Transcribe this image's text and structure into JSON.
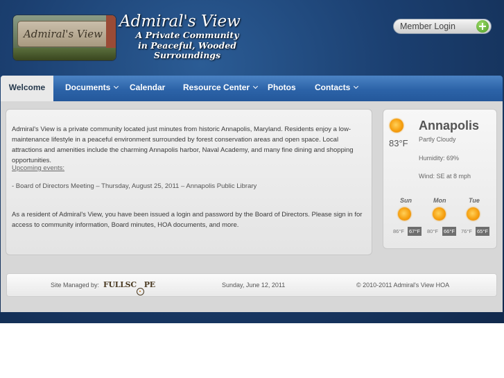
{
  "header": {
    "logo_sign_text": "Admiral's View",
    "site_title": "Admiral's View",
    "tagline_lines": [
      "A Private Community",
      "in Peaceful, Wooded",
      "Surroundings"
    ],
    "login_label": "Member Login"
  },
  "nav": {
    "items": [
      {
        "label": "Welcome",
        "active": true
      },
      {
        "label": "Documents",
        "dropdown": true
      },
      {
        "label": "Calendar"
      },
      {
        "label": "Resource Center",
        "dropdown": true
      },
      {
        "label": "Photos"
      },
      {
        "label": "Contacts",
        "dropdown": true
      }
    ]
  },
  "main": {
    "intro": "Admiral's View is a private community located just minutes from historic Annapolis, Maryland. Residents enjoy a low-maintenance lifestyle in a peaceful environment surrounded by forest conservation areas and open space. Local attractions and amenities include the charming Annapolis harbor, Naval Academy, and many fine dining and shopping opportunities.",
    "upcoming_label": "Upcoming events:",
    "event": "- Board of Directors Meeting – Thursday, August 25, 2011 – Annapolis Public Library",
    "login_note": "As a resident of Admiral's View, you have been issued a login and password by the Board of Directors. Please sign in for access to community information, Board minutes, HOA documents, and more."
  },
  "weather": {
    "city": "Annapolis",
    "temp": "83°F",
    "condition": "Partly Cloudy",
    "humidity": "Humidity: 69%",
    "wind": "Wind: SE at 8 mph",
    "forecast": [
      {
        "day": "Sun",
        "low": "86°F",
        "high": "67°F",
        "icon": "partly-cloudy-icon"
      },
      {
        "day": "Mon",
        "low": "80°F",
        "high": "66°F",
        "icon": "sunny-icon"
      },
      {
        "day": "Tue",
        "low": "76°F",
        "high": "65°F",
        "icon": "partly-cloudy-icon"
      }
    ]
  },
  "footer": {
    "managed_by": "Site Managed by:",
    "managed_logo": "FULLSCOPE",
    "date": "Sunday, June 12, 2011",
    "copyright": "© 2010-2011 Admiral's View HOA"
  },
  "colors": {
    "header_bg": "#1b3f70",
    "nav_bg": "#2c63a8",
    "content_bg": "#d7d7d7",
    "login_plus": "#4a9a24",
    "sun": "#f6a010"
  }
}
